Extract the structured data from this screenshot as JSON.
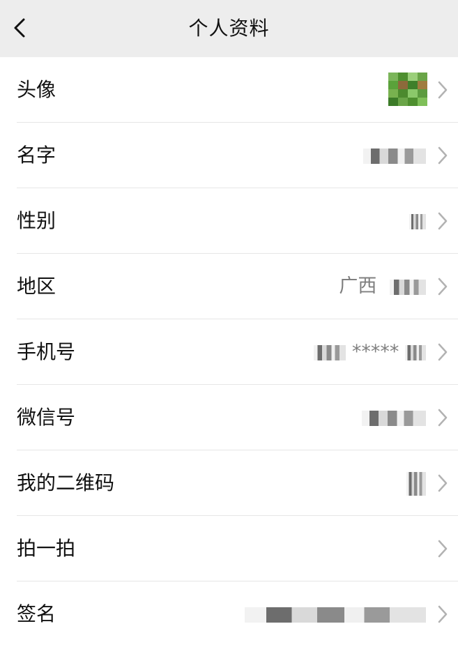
{
  "header": {
    "title": "个人资料"
  },
  "rows": [
    {
      "label": "头像",
      "value": ""
    },
    {
      "label": "名字",
      "value": ""
    },
    {
      "label": "性别",
      "value": ""
    },
    {
      "label": "地区",
      "value": "广西"
    },
    {
      "label": "手机号",
      "value": "*****"
    },
    {
      "label": "微信号",
      "value": ""
    },
    {
      "label": "我的二维码",
      "value": ""
    },
    {
      "label": "拍一拍",
      "value": ""
    },
    {
      "label": "签名",
      "value": ""
    }
  ],
  "icons": {
    "back": "chevron-left-icon",
    "row_arrow": "chevron-right-icon"
  },
  "colors": {
    "nav_bg": "#ededed",
    "text": "#111111",
    "value_text": "#7f7f7f",
    "separator": "#e6e6e6",
    "chevron": "#b2b2b2",
    "avatar_green": "#5aa23a"
  }
}
